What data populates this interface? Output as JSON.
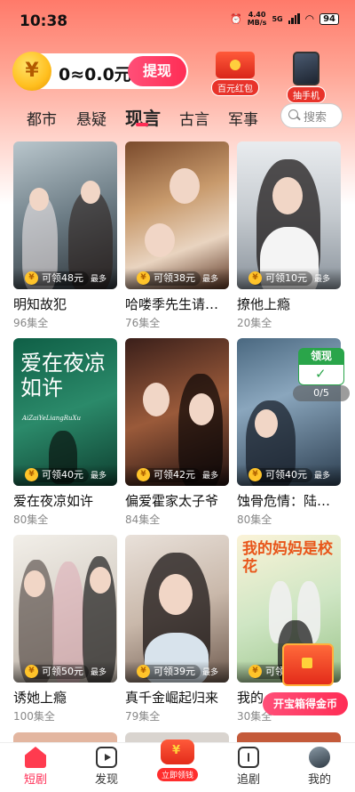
{
  "status_bar": {
    "time": "10:38",
    "net_speed_value": "4.40",
    "net_speed_unit": "MB/s",
    "network": "5G",
    "battery": "94"
  },
  "header": {
    "coin_icon": "¥",
    "balance": "0≈0.0元",
    "withdraw_label": "提现",
    "promos": [
      {
        "label": "百元红包",
        "icon": "red-packet-icon"
      },
      {
        "label": "抽手机",
        "icon": "phone-prize-icon"
      }
    ]
  },
  "tabs": {
    "items": [
      "都市",
      "悬疑",
      "现言",
      "古言",
      "军事"
    ],
    "active": "现言",
    "search_placeholder": "搜索"
  },
  "dramas": [
    {
      "title": "明知故犯",
      "episodes": "96集全",
      "reward": "可领48元",
      "max": "最多",
      "poster_text": "明知故犯"
    },
    {
      "title": "哈喽季先生请…",
      "episodes": "76集全",
      "reward": "可领38元",
      "max": "最多"
    },
    {
      "title": "撩他上瘾",
      "episodes": "20集全",
      "reward": "可领10元",
      "max": "最多"
    },
    {
      "title": "爱在夜凉如许",
      "episodes": "80集全",
      "reward": "可领40元",
      "max": "最多",
      "poster_text": "爱在夜凉如许",
      "poster_sub": "AiZaiYeLiangRuXu"
    },
    {
      "title": "偏爱霍家太子爷",
      "episodes": "84集全",
      "reward": "可领42元",
      "max": "最多"
    },
    {
      "title": "蚀骨危情：陆…",
      "episodes": "80集全",
      "reward": "可领40元",
      "max": "最多"
    },
    {
      "title": "诱她上瘾",
      "episodes": "100集全",
      "reward": "可领50元",
      "max": "最多"
    },
    {
      "title": "真千金崛起归来",
      "episodes": "79集全",
      "reward": "可领39元",
      "max": "最多"
    },
    {
      "title": "我的…",
      "episodes": "30集全",
      "reward": "可领",
      "max": "",
      "poster_text": "我的妈妈是校花"
    }
  ],
  "overlays": {
    "claim_badge": "领现",
    "claim_progress": "0/5",
    "treasure_label": "开宝箱得金币"
  },
  "bottom_nav": {
    "items": [
      {
        "label": "短剧",
        "icon": "home-icon",
        "active": true
      },
      {
        "label": "发现",
        "icon": "discover-icon",
        "active": false
      },
      {
        "label": "立即领钱",
        "icon": "cash-icon",
        "active": false
      },
      {
        "label": "追剧",
        "icon": "follow-icon",
        "active": false
      },
      {
        "label": "我的",
        "icon": "profile-avatar-icon",
        "active": false
      }
    ]
  },
  "colors": {
    "accent": "#ff2d55",
    "reward_green": "#2aa54a",
    "header_gradient_top": "#ff7a6a"
  }
}
